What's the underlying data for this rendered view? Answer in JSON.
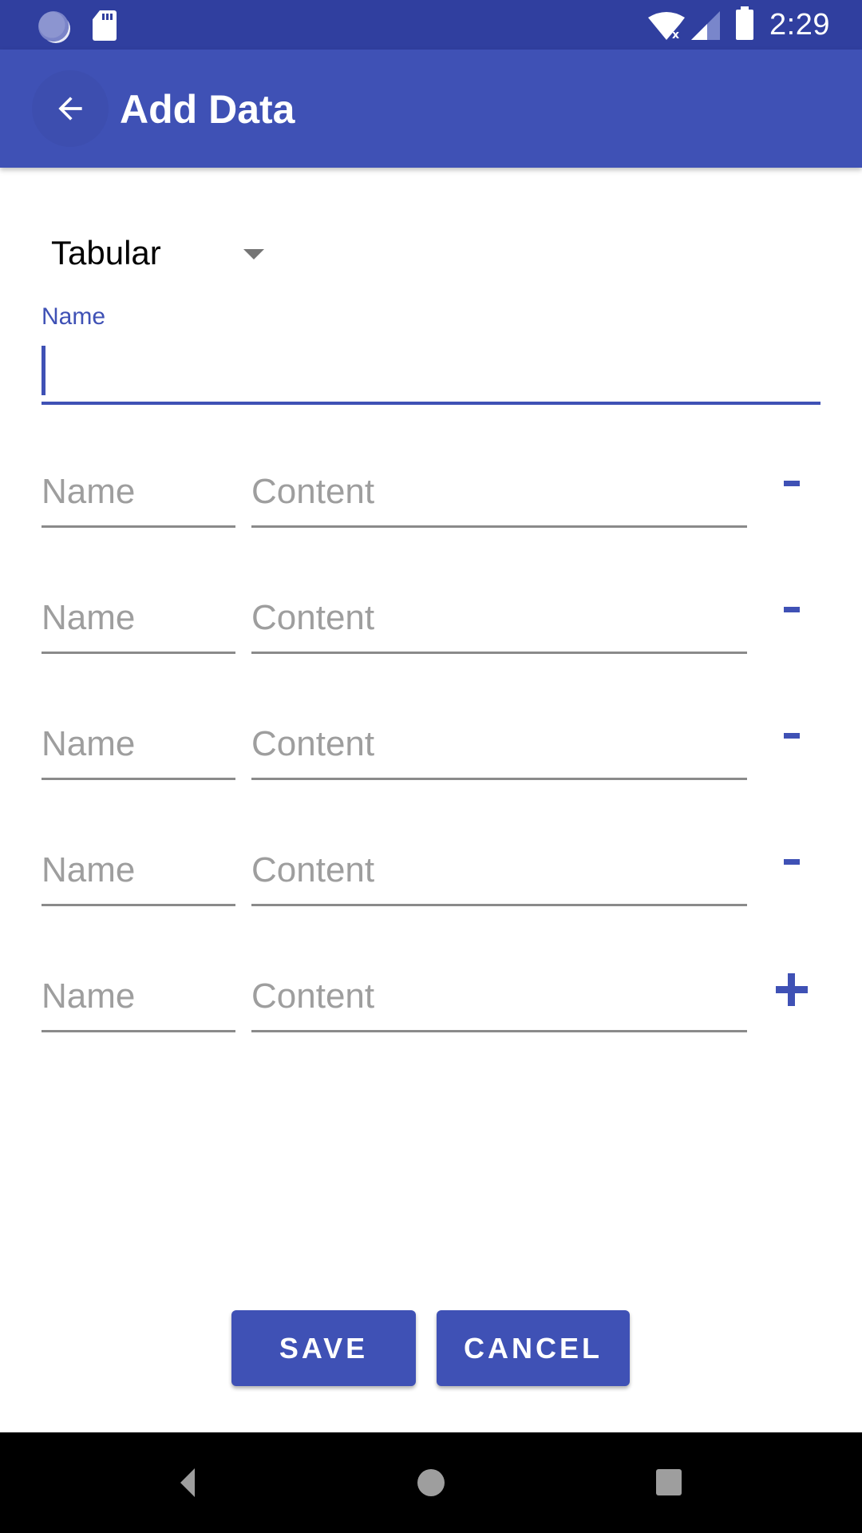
{
  "status_bar": {
    "time": "2:29",
    "left_icons": [
      "sync-icon",
      "sd-card-icon"
    ],
    "right_icons": [
      "wifi-no-internet-icon",
      "cell-signal-icon",
      "battery-icon"
    ]
  },
  "toolbar": {
    "title": "Add Data",
    "back_icon": "arrow-back-icon"
  },
  "form": {
    "type_selector": {
      "selected": "Tabular"
    },
    "name_field": {
      "label": "Name",
      "value": ""
    },
    "rows": [
      {
        "name_placeholder": "Name",
        "content_placeholder": "Content",
        "action": "remove",
        "action_glyph": "-"
      },
      {
        "name_placeholder": "Name",
        "content_placeholder": "Content",
        "action": "remove",
        "action_glyph": "-"
      },
      {
        "name_placeholder": "Name",
        "content_placeholder": "Content",
        "action": "remove",
        "action_glyph": "-"
      },
      {
        "name_placeholder": "Name",
        "content_placeholder": "Content",
        "action": "remove",
        "action_glyph": "-"
      },
      {
        "name_placeholder": "Name",
        "content_placeholder": "Content",
        "action": "add",
        "action_glyph": "+"
      }
    ]
  },
  "actions": {
    "save_label": "SAVE",
    "cancel_label": "CANCEL"
  },
  "nav_bar": {
    "buttons": [
      "back",
      "home",
      "recents"
    ]
  },
  "colors": {
    "primary": "#3f51b5",
    "primary_dark": "#303f9f",
    "hint": "#9e9e9e"
  }
}
